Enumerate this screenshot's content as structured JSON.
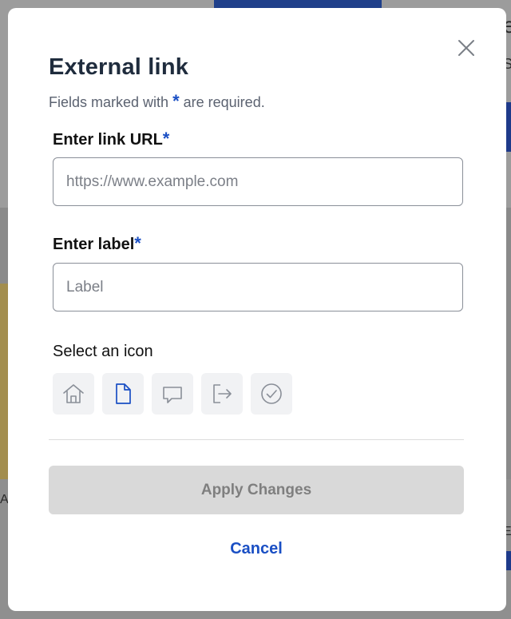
{
  "background": {
    "peek_letter_top": "e",
    "peek_letter_mid": "S",
    "peek_letter_left": "A",
    "peek_letter_right": "Ei"
  },
  "modal": {
    "title": "External link",
    "subtitle_before": "Fields marked with",
    "subtitle_after": "are required.",
    "required_marker": "*",
    "url_field": {
      "label": "Enter link URL",
      "placeholder": "https://www.example.com",
      "value": ""
    },
    "label_field": {
      "label": "Enter label",
      "placeholder": "Label",
      "value": ""
    },
    "icon_section_label": "Select an icon",
    "icons": [
      {
        "name": "home-icon",
        "selected": false
      },
      {
        "name": "document-icon",
        "selected": true
      },
      {
        "name": "chat-bubble-icon",
        "selected": false
      },
      {
        "name": "external-exit-icon",
        "selected": false
      },
      {
        "name": "check-circle-icon",
        "selected": false
      }
    ],
    "apply_label": "Apply Changes",
    "cancel_label": "Cancel"
  },
  "colors": {
    "accent": "#1a4fc4",
    "title": "#1f2c3d",
    "icon_default": "#8a8f98",
    "disabled_button_bg": "#d9d9d9",
    "disabled_button_text": "#7f7f7f"
  }
}
